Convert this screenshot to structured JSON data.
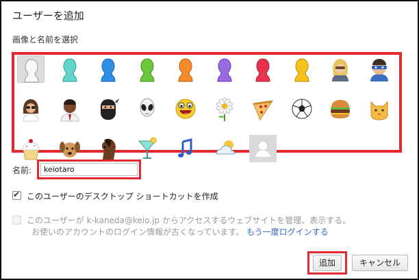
{
  "dialog": {
    "title": "ユーザーを追加",
    "section_label": "画像と名前を選択"
  },
  "avatars": [
    {
      "icon": "white-silhouette-icon",
      "selected": true
    },
    {
      "icon": "teal-silhouette-icon"
    },
    {
      "icon": "blue-silhouette-icon"
    },
    {
      "icon": "green-silhouette-icon"
    },
    {
      "icon": "orange-silhouette-icon"
    },
    {
      "icon": "purple-silhouette-icon"
    },
    {
      "icon": "red-silhouette-icon"
    },
    {
      "icon": "yellow-silhouette-icon"
    },
    {
      "icon": "blonde-woman-icon"
    },
    {
      "icon": "masked-man-icon"
    },
    {
      "icon": "sunglasses-woman-icon"
    },
    {
      "icon": "businessman-icon"
    },
    {
      "icon": "ninja-icon"
    },
    {
      "icon": "alien-icon"
    },
    {
      "icon": "smiley-face-icon"
    },
    {
      "icon": "daisy-flower-icon"
    },
    {
      "icon": "pizza-slice-icon"
    },
    {
      "icon": "soccer-ball-icon"
    },
    {
      "icon": "hamburger-icon"
    },
    {
      "icon": "cat-icon"
    },
    {
      "icon": "cupcake-icon"
    },
    {
      "icon": "dog-icon"
    },
    {
      "icon": "horse-icon"
    },
    {
      "icon": "cocktail-icon"
    },
    {
      "icon": "music-note-icon"
    },
    {
      "icon": "cloud-sun-icon"
    },
    {
      "icon": "generic-person-icon"
    }
  ],
  "name_field": {
    "label": "名前:",
    "value": "keiotaro"
  },
  "options": {
    "desktop_shortcut": {
      "label": "このユーザーのデスクトップ ショートカットを作成",
      "checked": true
    },
    "supervised": {
      "line1": "このユーザーが k-kaneda@keio.jp からアクセスするウェブサイトを管理、表示する。",
      "line2": "お使いのアカウントのログイン情報が古くなっています。",
      "link": "もう一度ログインする",
      "checked": false,
      "enabled": false
    }
  },
  "buttons": {
    "add": "追加",
    "cancel": "キャンセル"
  },
  "colors": {
    "highlight_outline": "#e3282f",
    "link": "#3567c9"
  }
}
